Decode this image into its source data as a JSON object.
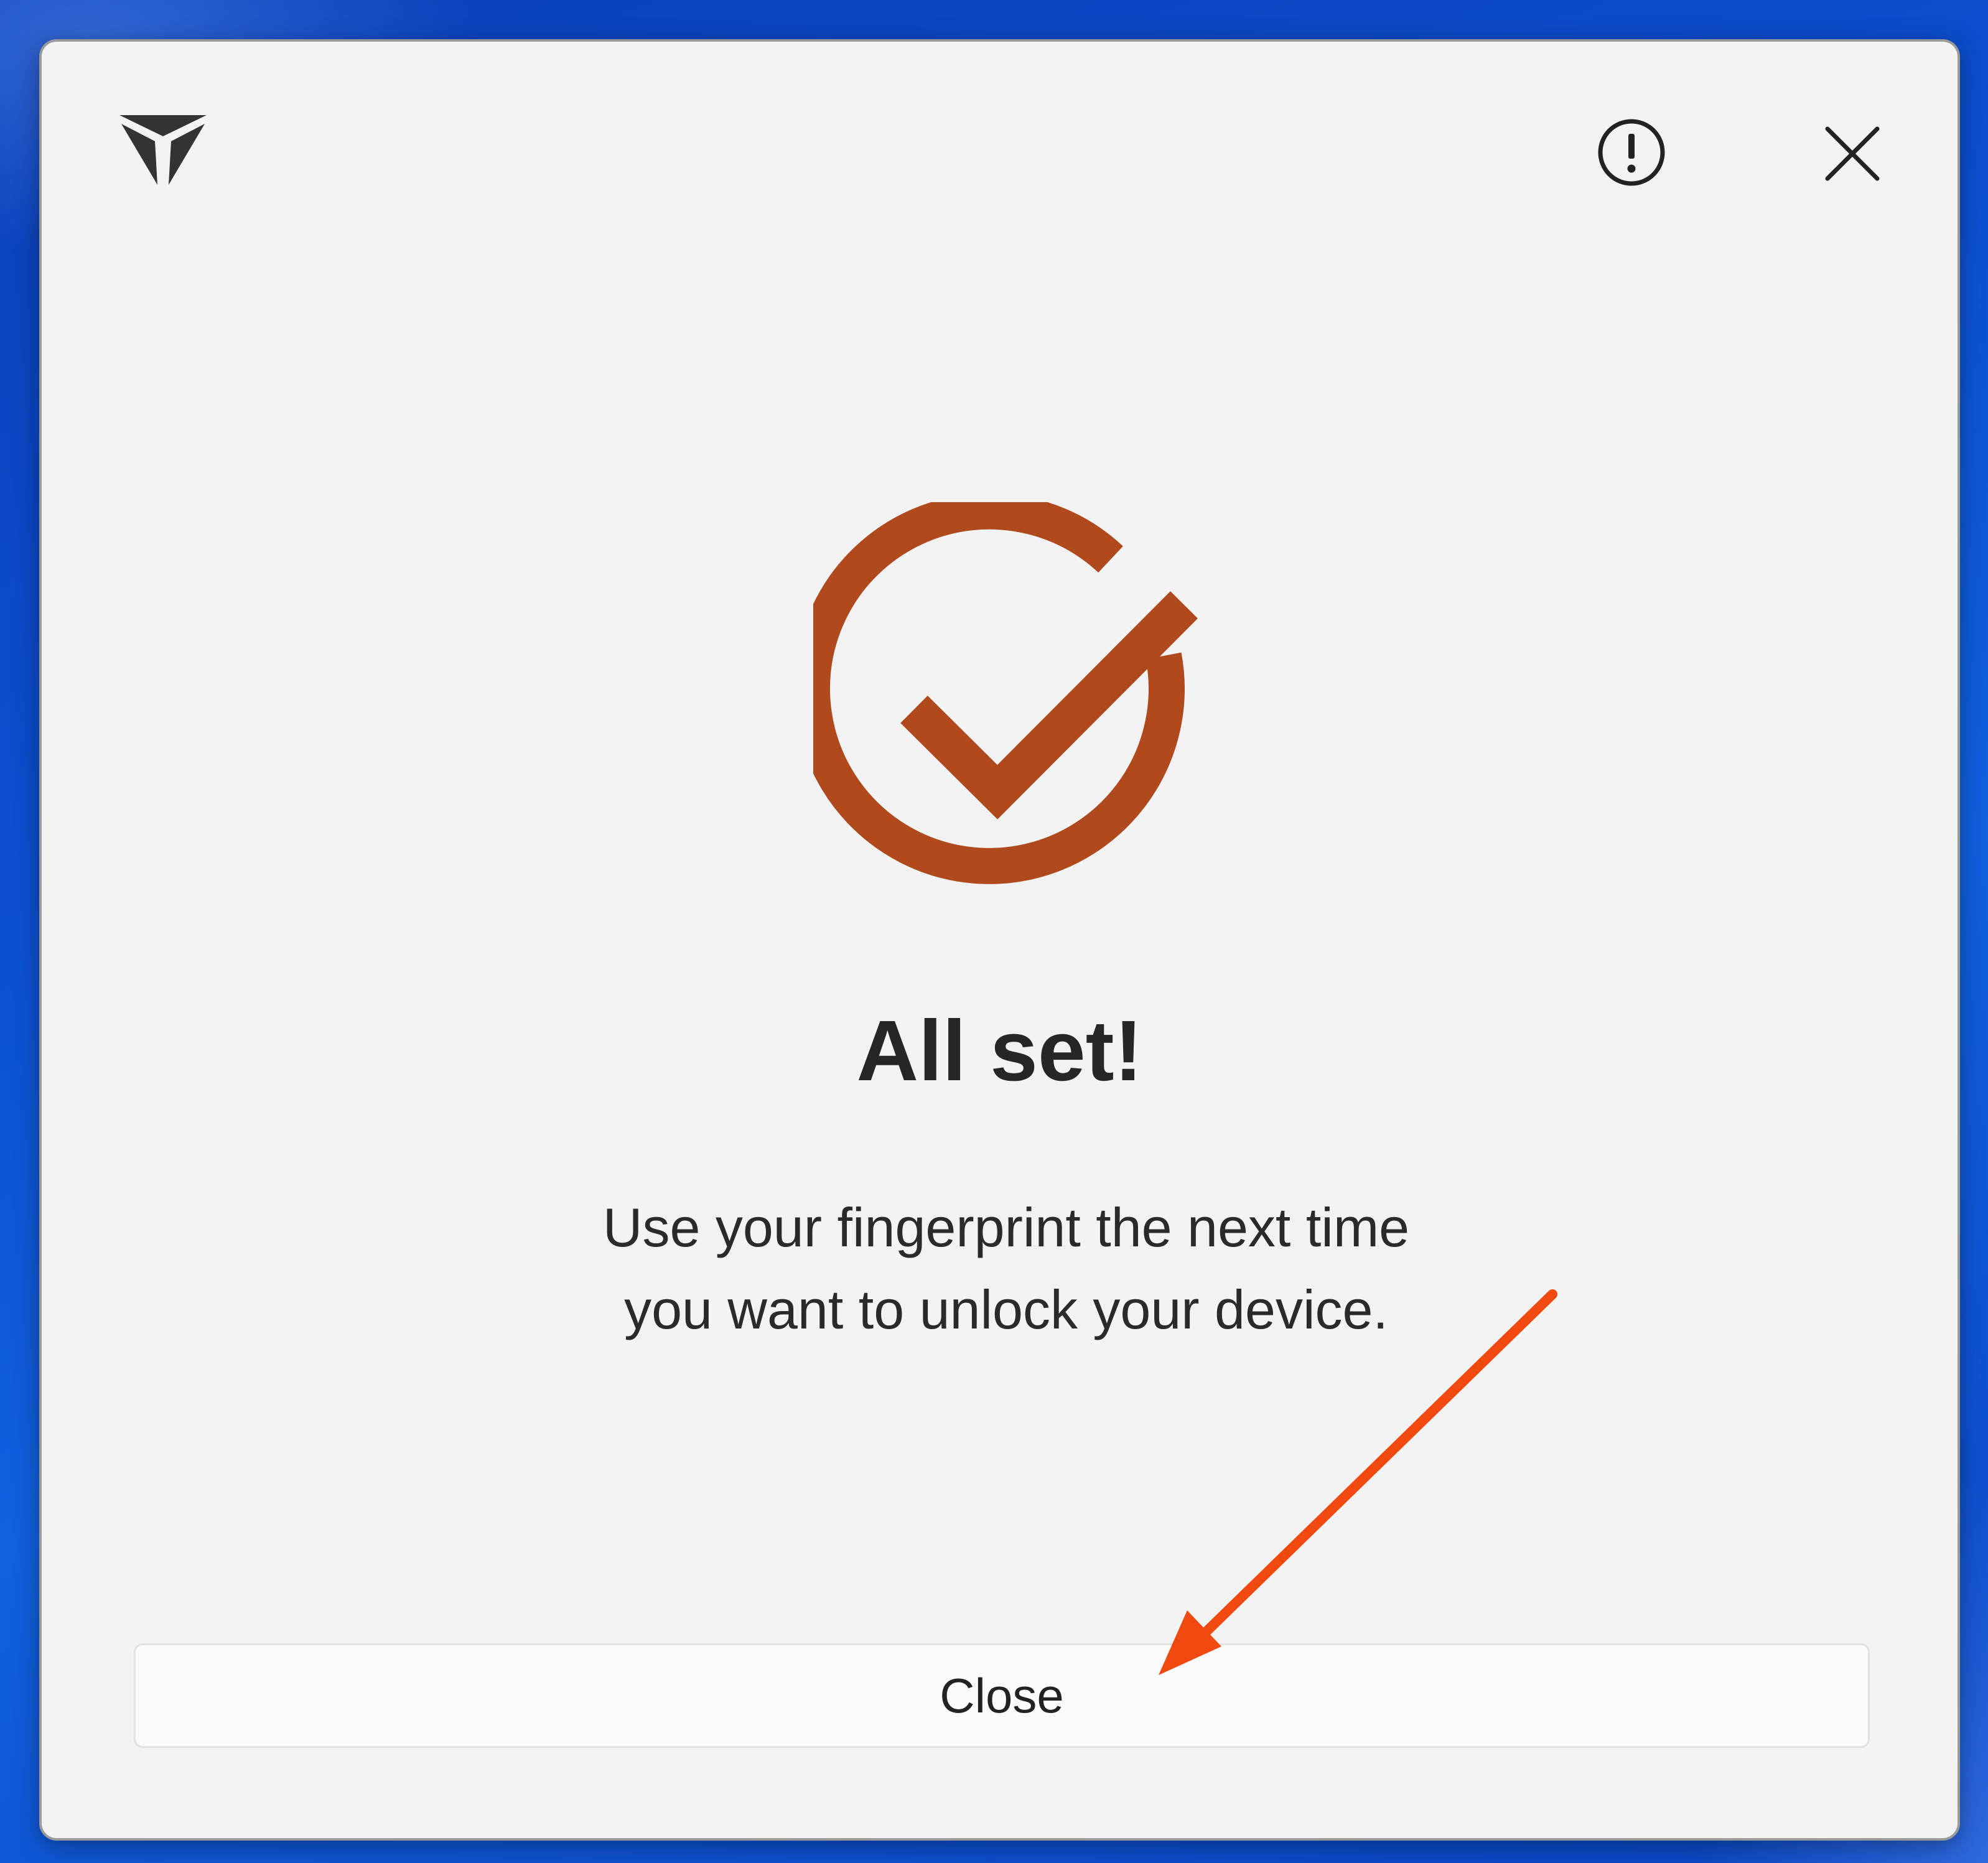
{
  "dialog": {
    "title": "All set!",
    "message_line1": "Use your fingerprint the next time",
    "message_line2": "you want to unlock your device.",
    "close_button_label": "Close"
  },
  "icons": {
    "logo": "brand-logo-icon",
    "info": "info-icon",
    "close": "close-icon",
    "success": "checkmark-circle-icon"
  },
  "colors": {
    "accent": "#b04a1c",
    "annotation_arrow": "#f04a10",
    "background": "#0b4fd0",
    "dialog_bg": "#f3f3f3"
  }
}
